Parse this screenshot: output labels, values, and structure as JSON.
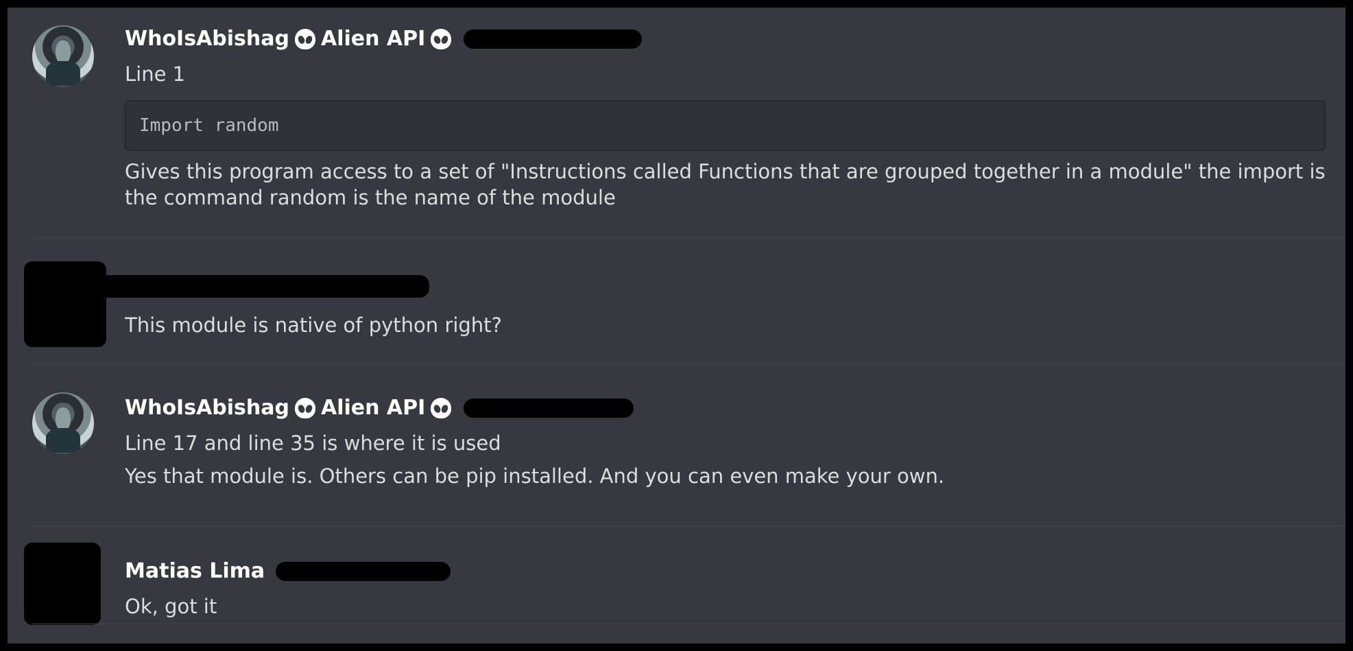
{
  "messages": [
    {
      "username": "WhoIsAbishag",
      "role": "Alien API",
      "lines": [
        "Line 1"
      ],
      "code": "Import random",
      "after_code": "Gives this program access to a set of \"Instructions called Functions that are grouped together in a module\" the import is the command random is the name of the module"
    },
    {
      "username": "",
      "lines": [
        "This module is native of python right?"
      ]
    },
    {
      "username": "WhoIsAbishag",
      "role": "Alien API",
      "lines": [
        "Line 17 and line 35 is where it is used",
        "Yes that module is. Others can be pip installed. And you can even make your own."
      ]
    },
    {
      "username": "Matias Lima",
      "lines": [
        "Ok, got it"
      ]
    }
  ],
  "icons": {
    "role_icon": "alien-icon",
    "avatar": "avatar"
  }
}
